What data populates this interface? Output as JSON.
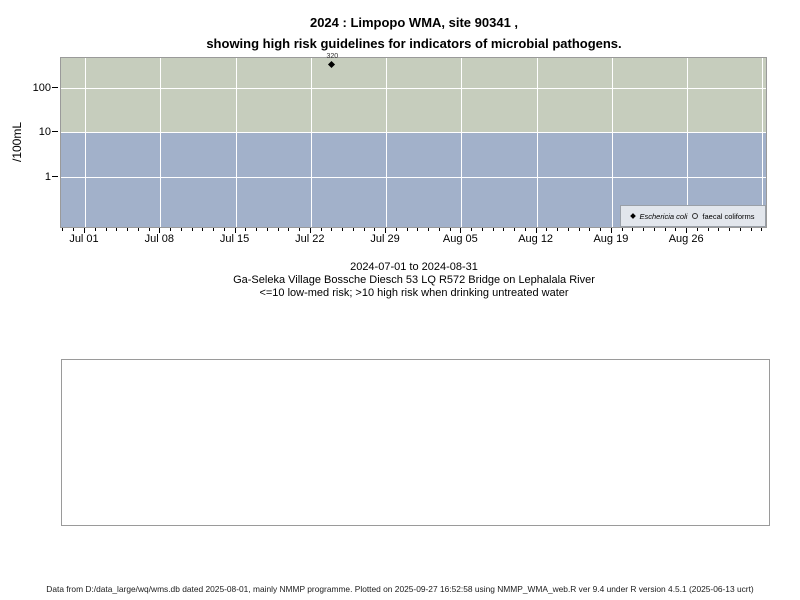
{
  "title": {
    "line1": "2024 : Limpopo WMA, site 90341 ,",
    "line2": "showing high risk guidelines for indicators of microbial pathogens."
  },
  "chart_data": {
    "type": "scatter",
    "ylabel": "/100mL",
    "y_scale": "log10",
    "y_ticks": [
      100,
      10,
      1
    ],
    "x_range": [
      "2024-07-01",
      "2024-08-31"
    ],
    "x_ticks": [
      "Jul 01",
      "Jul 08",
      "Jul 15",
      "Jul 22",
      "Jul 29",
      "Aug 05",
      "Aug 12",
      "Aug 19",
      "Aug 26"
    ],
    "series": [
      {
        "name": "Eschericia coli",
        "marker": "filled-diamond",
        "italic": true,
        "points": [
          {
            "date": "2024-07-24",
            "value": 320,
            "label": "320"
          }
        ]
      },
      {
        "name": "faecal coliforms",
        "marker": "open-circle",
        "italic": false,
        "points": []
      }
    ],
    "bands": [
      {
        "name": "high risk",
        "range": ">10",
        "color": "#c6cdbd"
      },
      {
        "name": "low-med risk",
        "range": "<=10",
        "color": "#a2b1ca"
      }
    ],
    "grid": true,
    "gridline_color": "#ffffff",
    "legend_position": "bottom-right",
    "risk_threshold": 10
  },
  "subtitle": {
    "line1": "2024-07-01 to 2024-08-31",
    "line2": "Ga-Seleka Village Bossche Diesch 53 LQ R572 Bridge on Lephalala River",
    "line3": "<=10 low-med risk; >10 high risk when drinking untreated water"
  },
  "footer": {
    "text": "Data from D:/data_large/wq/wms.db dated 2025-08-01, mainly NMMP programme. Plotted on 2025-09-27 16:52:58 using NMMP_WMA_web.R ver 9.4 under R version 4.5.1 (2025-06-13 ucrt)"
  }
}
